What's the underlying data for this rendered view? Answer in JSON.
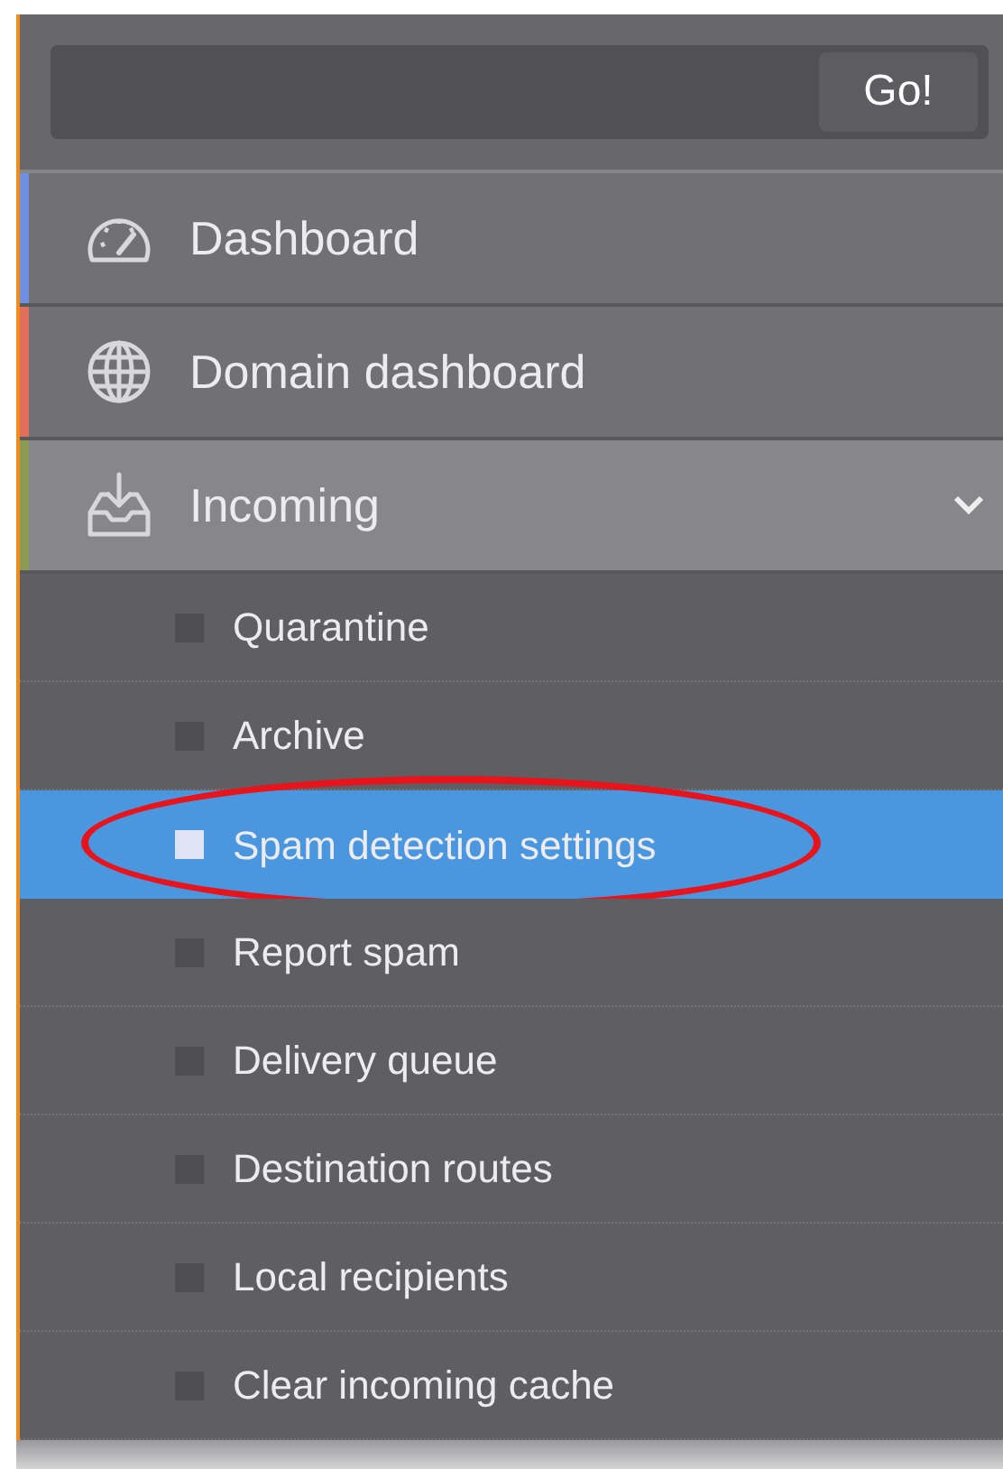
{
  "search": {
    "button": "Go!"
  },
  "menu": [
    {
      "label": "Dashboard",
      "kind": "gauge",
      "color": "#6f8fe0",
      "expanded": false
    },
    {
      "label": "Domain dashboard",
      "kind": "globe",
      "color": "#e0705a",
      "expanded": false
    },
    {
      "label": "Incoming",
      "kind": "inbox",
      "color": "#8a9a50",
      "expanded": true,
      "children": [
        {
          "label": "Quarantine",
          "selected": false,
          "circled": false
        },
        {
          "label": "Archive",
          "selected": false,
          "circled": false
        },
        {
          "label": "Spam detection settings",
          "selected": true,
          "circled": true
        },
        {
          "label": "Report spam",
          "selected": false,
          "circled": false
        },
        {
          "label": "Delivery queue",
          "selected": false,
          "circled": false
        },
        {
          "label": "Destination routes",
          "selected": false,
          "circled": false
        },
        {
          "label": "Local recipients",
          "selected": false,
          "circled": false
        },
        {
          "label": "Clear incoming cache",
          "selected": false,
          "circled": false
        }
      ]
    }
  ]
}
